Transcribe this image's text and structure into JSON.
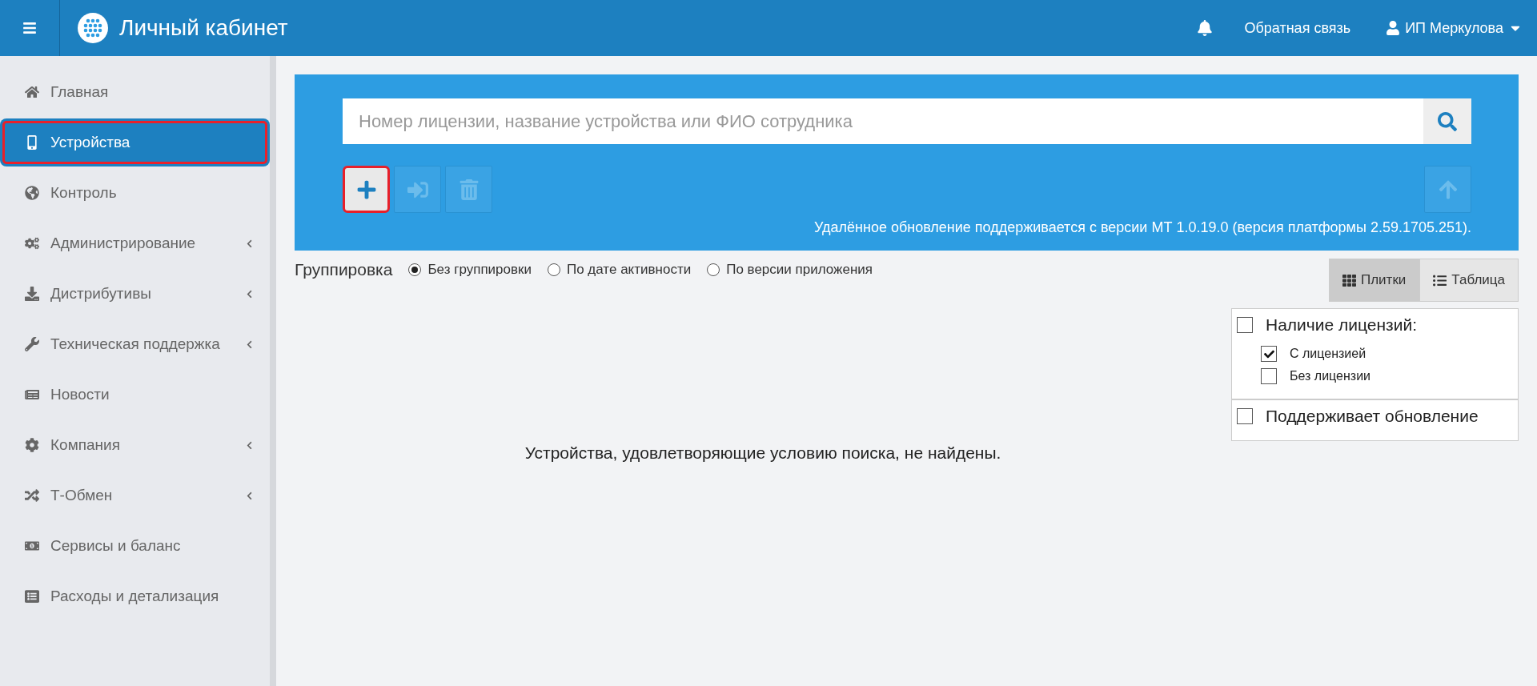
{
  "header": {
    "title": "Личный кабинет",
    "feedback": "Обратная связь",
    "user": "ИП Меркулова"
  },
  "sidebar": {
    "items": [
      {
        "label": "Главная",
        "selected": false,
        "expandable": false
      },
      {
        "label": "Устройства",
        "selected": true,
        "expandable": false
      },
      {
        "label": "Контроль",
        "selected": false,
        "expandable": false
      },
      {
        "label": "Администрирование",
        "selected": false,
        "expandable": true
      },
      {
        "label": "Дистрибутивы",
        "selected": false,
        "expandable": true
      },
      {
        "label": "Техническая поддержка",
        "selected": false,
        "expandable": true
      },
      {
        "label": "Новости",
        "selected": false,
        "expandable": false
      },
      {
        "label": "Компания",
        "selected": false,
        "expandable": true
      },
      {
        "label": "Т-Обмен",
        "selected": false,
        "expandable": true
      },
      {
        "label": "Сервисы и баланс",
        "selected": false,
        "expandable": false
      },
      {
        "label": "Расходы и детализация",
        "selected": false,
        "expandable": false
      }
    ]
  },
  "search": {
    "placeholder": "Номер лицензии, название устройства или ФИО сотрудника"
  },
  "toolbar": {
    "buttons": [
      {
        "disabled": false,
        "highlighted": true
      },
      {
        "disabled": true,
        "highlighted": false
      },
      {
        "disabled": true,
        "highlighted": false
      }
    ],
    "upload_button": {
      "disabled": true
    },
    "note": "Удалённое обновление поддерживается с версии МТ 1.0.19.0 (версия платформы 2.59.1705.251)."
  },
  "grouping": {
    "label": "Группировка",
    "options": [
      {
        "label": "Без группировки",
        "selected": true
      },
      {
        "label": "По дате активности",
        "selected": false
      },
      {
        "label": "По версии приложения",
        "selected": false
      }
    ]
  },
  "view_tabs": [
    {
      "label": "Плитки",
      "selected": true
    },
    {
      "label": "Таблица",
      "selected": false
    }
  ],
  "filters": [
    {
      "label": "Наличие лицензий:",
      "checked": false,
      "children": [
        {
          "label": "С лицензией",
          "checked": true
        },
        {
          "label": "Без лицензии",
          "checked": false
        }
      ]
    },
    {
      "label": "Поддерживает обновление",
      "checked": false
    }
  ],
  "empty_message": "Устройства, удовлетворяющие условию поиска, не найдены."
}
